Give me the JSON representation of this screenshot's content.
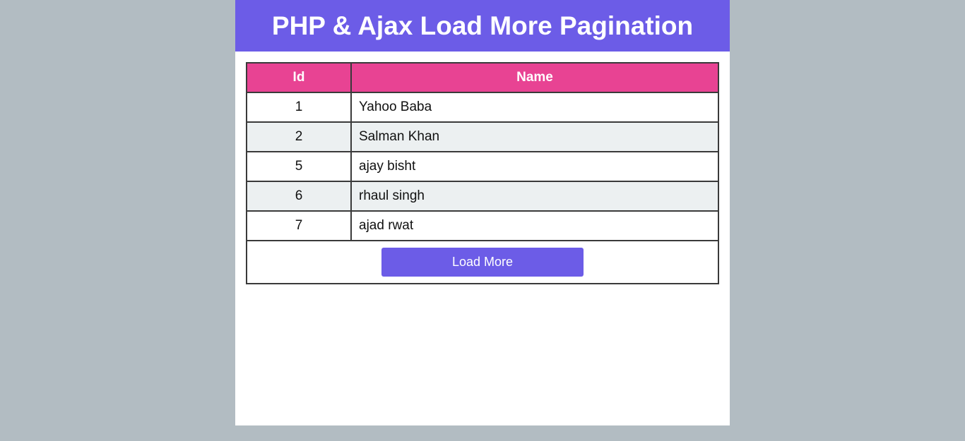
{
  "header": {
    "title": "PHP & Ajax Load More Pagination"
  },
  "table": {
    "columns": [
      "Id",
      "Name"
    ],
    "rows": [
      {
        "id": "1",
        "name": "Yahoo Baba"
      },
      {
        "id": "2",
        "name": "Salman Khan"
      },
      {
        "id": "5",
        "name": "ajay bisht"
      },
      {
        "id": "6",
        "name": "rhaul singh"
      },
      {
        "id": "7",
        "name": "ajad rwat"
      }
    ]
  },
  "load_more": {
    "label": "Load More"
  },
  "colors": {
    "header_bg": "#6c5ce7",
    "table_header_bg": "#e84393",
    "stripe_bg": "#ecf0f1",
    "button_bg": "#6c5ce7",
    "page_bg": "#b2bcc2"
  }
}
